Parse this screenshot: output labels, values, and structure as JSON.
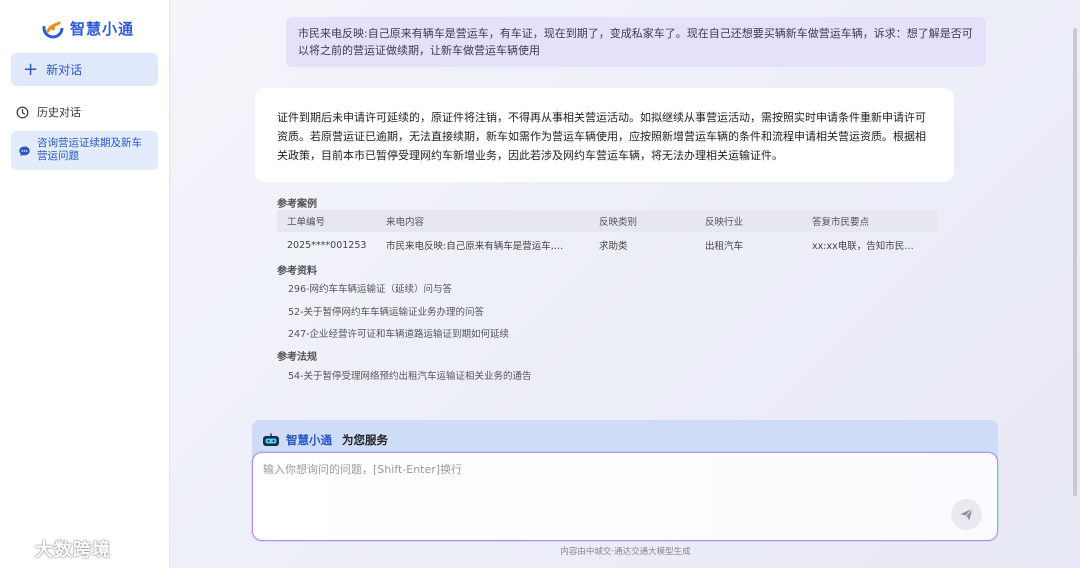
{
  "sidebar": {
    "logo_text": "智慧小通",
    "new_chat_label": "新对话",
    "history_title": "历史对话",
    "conversations": [
      "咨询营运证续期及新车营运问题"
    ]
  },
  "chat": {
    "user_message": "市民来电反映:自己原来有辆车是营运车，有车证，现在到期了，变成私家车了。现在自己还想要买辆新车做营运车辆，诉求：想了解是否可以将之前的营运证做续期，让新车做营运车辆使用",
    "answer": "证件到期后未申请许可延续的，原证件将注销，不得再从事相关营运活动。如拟继续从事营运活动，需按照实时申请条件重新申请许可资质。若原营运证已逾期，无法直接续期，新车如需作为营运车辆使用，应按照新增营运车辆的条件和流程申请相关营运资质。根据相关政策，目前本市已暂停受理网约车新增业务，因此若涉及网约车营运车辆，将无法办理相关运输证件。"
  },
  "references": {
    "cases_title": "参考案例",
    "table_headers": [
      "工单编号",
      "来电内容",
      "反映类别",
      "反映行业",
      "答复市民要点"
    ],
    "table_rows": [
      [
        "2025****001253",
        "市民来电反映:自己原来有辆车是营运车,…",
        "求助类",
        "出租汽车",
        "xx:xx电联，告知市民…"
      ]
    ],
    "materials_title": "参考资料",
    "materials": [
      "296-网约车车辆运输证（延续）问与答",
      "52-关于暂停网约车车辆运输证业务办理的问答",
      "247-企业经营许可证和车辆道路运输证到期如何延续"
    ],
    "regulations_title": "参考法规",
    "regulations": [
      "54-关于暂停受理网络预约出租汽车运输证相关业务的通告"
    ]
  },
  "input": {
    "brand_name": "智慧小通",
    "brand_suffix": "为您服务",
    "placeholder": "输入你想询问的问题，[Shift-Enter]换行"
  },
  "footer_note": "内容由中城交·通达交通大模型生成",
  "watermark_text": "大数跨境",
  "icons": {
    "logo": "logo-icon",
    "new_chat": "plus-icon",
    "history": "clock-icon",
    "conversation": "chat-bubble-icon",
    "bot": "robot-icon",
    "send": "send-icon"
  },
  "colors": {
    "accent": "#2b56c9",
    "user_bubble": "#e4e2fa",
    "input_border": "#b98df0"
  }
}
